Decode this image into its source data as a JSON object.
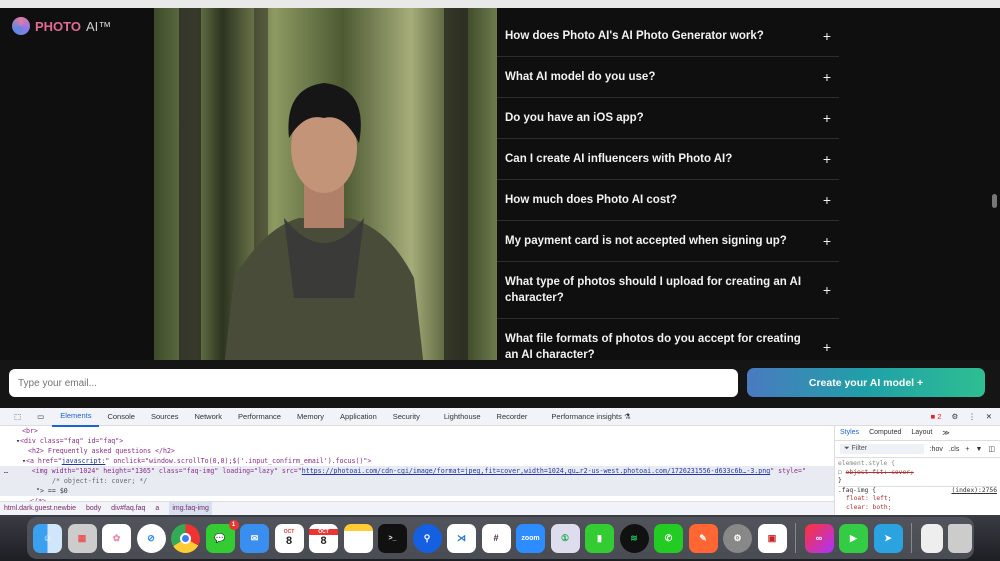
{
  "site": {
    "logo": {
      "brand": "PHOTO",
      "suffix": "AI™"
    },
    "faq": [
      "How does Photo AI's AI Photo Generator work?",
      "What AI model do you use?",
      "Do you have an iOS app?",
      "Can I create AI influencers with Photo AI?",
      "How much does Photo AI cost?",
      "My payment card is not accepted when signing up?",
      "What type of photos should I upload for creating an AI character?",
      "What file formats of photos do you accept for creating an AI character?"
    ],
    "expand_symbol": "+",
    "email_placeholder": "Type your email...",
    "cta_label": "Create your AI model +"
  },
  "devtools": {
    "tabs": [
      "Elements",
      "Console",
      "Sources",
      "Network",
      "Performance",
      "Memory",
      "Application",
      "Security",
      "Lighthouse",
      "Recorder",
      "Performance insights ⚗"
    ],
    "issues_count": "2",
    "code": {
      "l1": "<br>",
      "l2_tag": "<div class=\"faq\" id=\"faq\">",
      "l3": "<h2> Frequently asked questions </h2>",
      "l4_a": "<a href=\"",
      "l4_link": "javascript:",
      "l4_b": "\" onclick=\"window.scrollTo(0,0);$('.input_confirm_email').focus()\">",
      "l5_a": "<img width=\"1024\" height=\"1365\" class=\"faq-img\" loading=\"lazy\" src=\"",
      "l5_link": "https://photoai.com/cdn-cgi/image/format=jpeg,fit=cover,width=1024,qu…r2-us-west.photoai.com/1726231556-d633c6b…-3.png",
      "l5_b": "\" style=\"",
      "l6": "/* object-fit: cover; */",
      "l7": "\"> == $0",
      "l8": "</a>"
    },
    "breadcrumbs": [
      "html.dark.guest.newbie",
      "body",
      "div#faq.faq",
      "a",
      "img.faq-img"
    ],
    "styles": {
      "tabs": [
        "Styles",
        "Computed",
        "Layout",
        "≫"
      ],
      "filter": "Filter",
      "hov": ":hov",
      "cls": ".cls",
      "element_style": "element.style {",
      "struck": "object-fit: cover;",
      "close": "}",
      "rule": ".faq-img {",
      "source": "(index):2756",
      "p1": "float: left;",
      "p2": "clear: both;"
    }
  },
  "dock": {
    "apps": [
      "Finder",
      "Launchpad",
      "Photos",
      "Safari",
      "Chrome",
      "Messages",
      "Mail",
      "Calendar",
      "Calendar",
      "Notes",
      "Terminal",
      "Maps Pin",
      "VS Code",
      "Slack",
      "Zoom",
      "1Password",
      "Numbers",
      "Spotify",
      "WhatsApp",
      "Sketch Pen",
      "System Settings",
      "Radio",
      "Creative Cloud",
      "FaceTime",
      "Telegram",
      "Document",
      "Trash"
    ],
    "messages_badge": "1",
    "calendar_month": "OCT",
    "calendar_day": "8",
    "zoom_label": "zoom"
  }
}
